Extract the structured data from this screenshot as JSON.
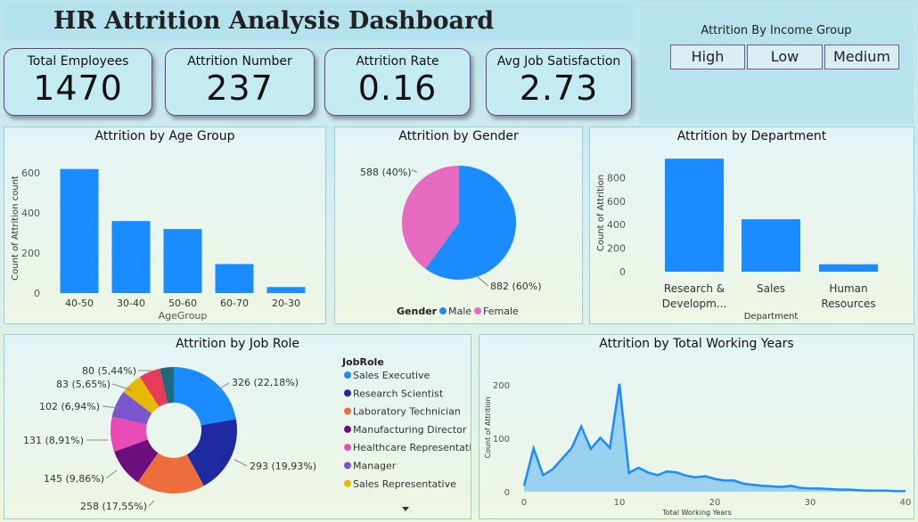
{
  "header": {
    "title": "HR Attrition Analysis Dashboard"
  },
  "kpis": [
    {
      "label": "Total Employees",
      "value": "1470"
    },
    {
      "label": "Attrition Number",
      "value": "237"
    },
    {
      "label": "Attrition Rate",
      "value": "0.16"
    },
    {
      "label": "Avg Job Satisfaction",
      "value": "2.73"
    }
  ],
  "slicer": {
    "title": "Attrition By Income Group",
    "options": [
      "High",
      "Low",
      "Medium"
    ]
  },
  "colors": {
    "blue": "#1a8cff",
    "pink": "#e66bc0",
    "area": "#8ccaee",
    "line": "#1a8cff"
  },
  "chart_data": [
    {
      "type": "bar",
      "title": "Attrition by Age Group",
      "categories": [
        "40-50",
        "30-40",
        "50-60",
        "60-70",
        "20-30"
      ],
      "values": [
        620,
        360,
        320,
        145,
        30
      ],
      "xlabel": "AgeGroup",
      "ylabel": "Count of Attrition count",
      "yticks": [
        "0",
        "200",
        "400",
        "600"
      ],
      "ylim": [
        0,
        650
      ]
    },
    {
      "type": "pie",
      "title": "Attrition by Gender",
      "legend_title": "Gender",
      "slices": [
        {
          "name": "Male",
          "value": 882,
          "label": "882 (60%)"
        },
        {
          "name": "Female",
          "value": 588,
          "label": "588 (40%)"
        }
      ]
    },
    {
      "type": "bar",
      "title": "Attrition by Department",
      "categories": [
        "Research & Developm...",
        "Sales",
        "Human Resources"
      ],
      "values": [
        961,
        446,
        63
      ],
      "xlabel": "Department",
      "ylabel": "Count of Attrition",
      "yticks": [
        "0",
        "200",
        "400",
        "600",
        "800"
      ],
      "ylim": [
        0,
        1000
      ]
    },
    {
      "type": "pie",
      "title": "Attrition by Job Role",
      "legend_title": "JobRole",
      "slices": [
        {
          "name": "Sales Executive",
          "value": 326,
          "label": "326 (22,18%)"
        },
        {
          "name": "Research Scientist",
          "value": 293,
          "label": "293 (19,93%)"
        },
        {
          "name": "Laboratory Technician",
          "value": 258,
          "label": "258 (17,55%)"
        },
        {
          "name": "Manufacturing Director",
          "value": 145,
          "label": "145 (9,86%)"
        },
        {
          "name": "Healthcare Representative",
          "value": 131,
          "label": "131 (8,91%)"
        },
        {
          "name": "Manager",
          "value": 102,
          "label": "102 (6,94%)"
        },
        {
          "name": "Sales Representative",
          "value": 83,
          "label": "83 (5,65%)"
        },
        {
          "name": "",
          "value": 80,
          "label": "80 (5,44%)"
        },
        {
          "name": "",
          "value": 52,
          "label": ""
        }
      ],
      "slice_colors": [
        "#1a8cff",
        "#1f2aa0",
        "#ec6e3c",
        "#6b0f80",
        "#e94bb6",
        "#7a55cc",
        "#e6b800",
        "#e63c5a",
        "#1d6b78"
      ]
    },
    {
      "type": "area",
      "title": "Attrition by Total Working Years",
      "xlabel": "Total Working Years",
      "ylabel": "Count of Attrition",
      "xticks": [
        "0",
        "10",
        "20",
        "30",
        "40"
      ],
      "yticks": [
        "0",
        "100",
        "200"
      ],
      "xlim": [
        0,
        40
      ],
      "ylim": [
        0,
        200
      ],
      "x": [
        0,
        1,
        2,
        3,
        4,
        5,
        6,
        7,
        8,
        9,
        10,
        11,
        12,
        13,
        14,
        15,
        16,
        17,
        18,
        19,
        20,
        21,
        22,
        23,
        24,
        25,
        26,
        27,
        28,
        29,
        30,
        31,
        32,
        33,
        34,
        35,
        36,
        37,
        38,
        39,
        40
      ],
      "y": [
        11,
        81,
        31,
        42,
        62,
        82,
        122,
        80,
        101,
        82,
        202,
        35,
        45,
        36,
        31,
        38,
        36,
        30,
        27,
        29,
        24,
        21,
        21,
        15,
        13,
        11,
        10,
        9,
        11,
        7,
        6,
        6,
        5,
        4,
        4,
        3,
        2,
        2,
        2,
        1,
        1
      ]
    }
  ]
}
